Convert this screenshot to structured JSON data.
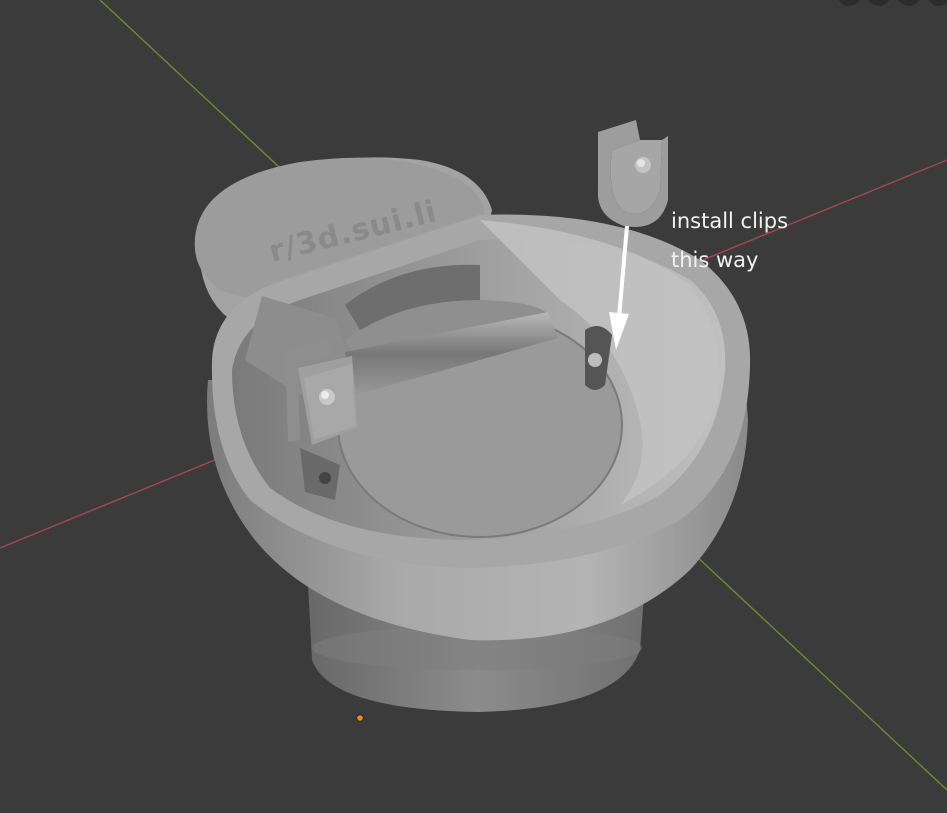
{
  "viewport": {
    "annotation": {
      "line1": "install clips",
      "line2": "this way"
    },
    "lid_engraving": "r/3d.sui.li"
  },
  "colors": {
    "background": "#3b3b3b",
    "x_axis": "#a8455a",
    "y_axis": "#6f8a2c",
    "model": "#9a9a9a",
    "origin_dot": "#f08a1c",
    "annotation_text": "#f2f2f2"
  },
  "icons": [
    "viewport-gizmo-icon",
    "origin-point-icon",
    "arrow-down-icon"
  ]
}
